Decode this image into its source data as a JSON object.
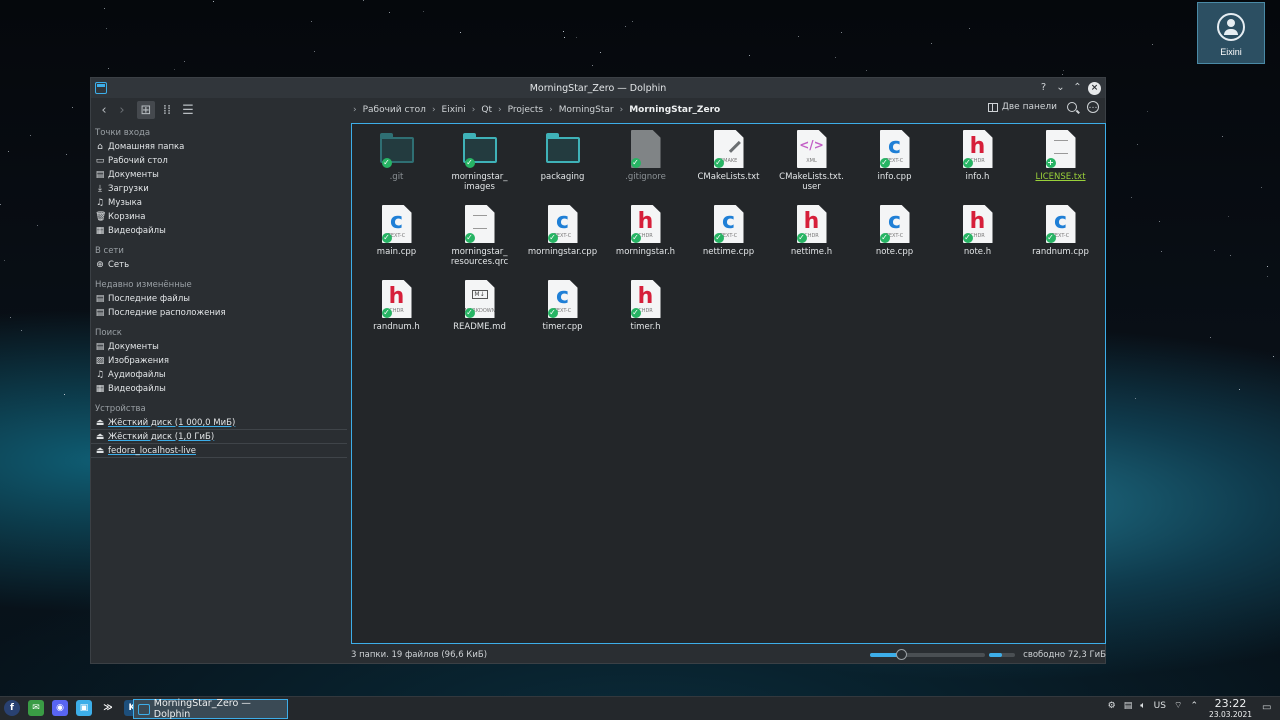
{
  "user": {
    "name": "Eixini"
  },
  "window": {
    "title": "MorningStar_Zero — Dolphin",
    "buttons": {
      "help": "?",
      "minimize": "⌄",
      "maximize": "⌃",
      "close": "×"
    }
  },
  "toolbar": {
    "breadcrumbs": [
      "Рабочий стол",
      "Eixini",
      "Qt",
      "Projects",
      "MorningStar",
      "MorningStar_Zero"
    ],
    "split_label": "Две панели"
  },
  "sidebar": {
    "sections": [
      {
        "title": "Точки входа",
        "items": [
          {
            "label": "Домашняя папка",
            "icon": "home-icon"
          },
          {
            "label": "Рабочий стол",
            "icon": "desktop-icon"
          },
          {
            "label": "Документы",
            "icon": "documents-icon"
          },
          {
            "label": "Загрузки",
            "icon": "downloads-icon"
          },
          {
            "label": "Музыка",
            "icon": "music-icon"
          },
          {
            "label": "Корзина",
            "icon": "trash-icon"
          },
          {
            "label": "Видеофайлы",
            "icon": "video-icon"
          }
        ]
      },
      {
        "title": "В сети",
        "items": [
          {
            "label": "Сеть",
            "icon": "network-icon"
          }
        ]
      },
      {
        "title": "Недавно изменённые",
        "items": [
          {
            "label": "Последние файлы",
            "icon": "recent-files-icon"
          },
          {
            "label": "Последние расположения",
            "icon": "recent-locations-icon"
          }
        ]
      },
      {
        "title": "Поиск",
        "items": [
          {
            "label": "Документы",
            "icon": "documents-icon"
          },
          {
            "label": "Изображения",
            "icon": "images-icon"
          },
          {
            "label": "Аудиофайлы",
            "icon": "audio-icon"
          },
          {
            "label": "Видеофайлы",
            "icon": "video-icon"
          }
        ]
      },
      {
        "title": "Устройства",
        "items": [
          {
            "label": "Жёсткий диск (1 000,0 МиБ)",
            "icon": "drive-icon"
          },
          {
            "label": "Жёсткий диск (1,0 ГиБ)",
            "icon": "drive-icon"
          },
          {
            "label": "fedora_localhost-live",
            "icon": "drive-icon"
          }
        ]
      }
    ]
  },
  "files": [
    {
      "name": ".git",
      "kind": "folder",
      "dim": true
    },
    {
      "name": "morningstar_\nimages",
      "kind": "folder"
    },
    {
      "name": "packaging",
      "kind": "folder",
      "nobadge": true
    },
    {
      "name": ".gitignore",
      "kind": "gray",
      "dim": true
    },
    {
      "name": "CMakeLists.txt",
      "kind": "cmake",
      "label": "CMAKE"
    },
    {
      "name": "CMakeLists.txt.\nuser",
      "kind": "xml",
      "label": "XML",
      "nobadge": true
    },
    {
      "name": "info.cpp",
      "kind": "c",
      "label": "TEXT-C"
    },
    {
      "name": "info.h",
      "kind": "h",
      "label": "CHDR"
    },
    {
      "name": "LICENSE.txt",
      "kind": "text",
      "green": true,
      "plus": true
    },
    {
      "name": "main.cpp",
      "kind": "c",
      "label": "TEXT-C"
    },
    {
      "name": "morningstar_\nresources.qrc",
      "kind": "text"
    },
    {
      "name": "morningstar.cpp",
      "kind": "c",
      "label": "TEXT-C"
    },
    {
      "name": "morningstar.h",
      "kind": "h",
      "label": "CHDR"
    },
    {
      "name": "nettime.cpp",
      "kind": "c",
      "label": "TEXT-C"
    },
    {
      "name": "nettime.h",
      "kind": "h",
      "label": "CHDR"
    },
    {
      "name": "note.cpp",
      "kind": "c",
      "label": "TEXT-C"
    },
    {
      "name": "note.h",
      "kind": "h",
      "label": "CHDR"
    },
    {
      "name": "randnum.cpp",
      "kind": "c",
      "label": "TEXT-C"
    },
    {
      "name": "randnum.h",
      "kind": "h",
      "label": "CHDR"
    },
    {
      "name": "README.md",
      "kind": "md",
      "label": "MARKDOWN"
    },
    {
      "name": "timer.cpp",
      "kind": "c",
      "label": "TEXT-C"
    },
    {
      "name": "timer.h",
      "kind": "h",
      "label": "CHDR"
    }
  ],
  "status": {
    "summary": "3 папки. 19 файлов (96,6 КиБ)",
    "free": "свободно 72,3 ГиБ",
    "zoom_fraction": 0.27,
    "used_fraction": 0.5
  },
  "taskbar": {
    "task_label": "MorningStar_Zero — Dolphin",
    "keyboard_layout": "US",
    "time": "23:22",
    "date": "23.03.2021"
  },
  "colors": {
    "accent": "#3daee9",
    "folder": "#3fb2b8",
    "badge": "#27b464",
    "c_letter": "#1f7fd6",
    "h_letter": "#d61f3a"
  }
}
